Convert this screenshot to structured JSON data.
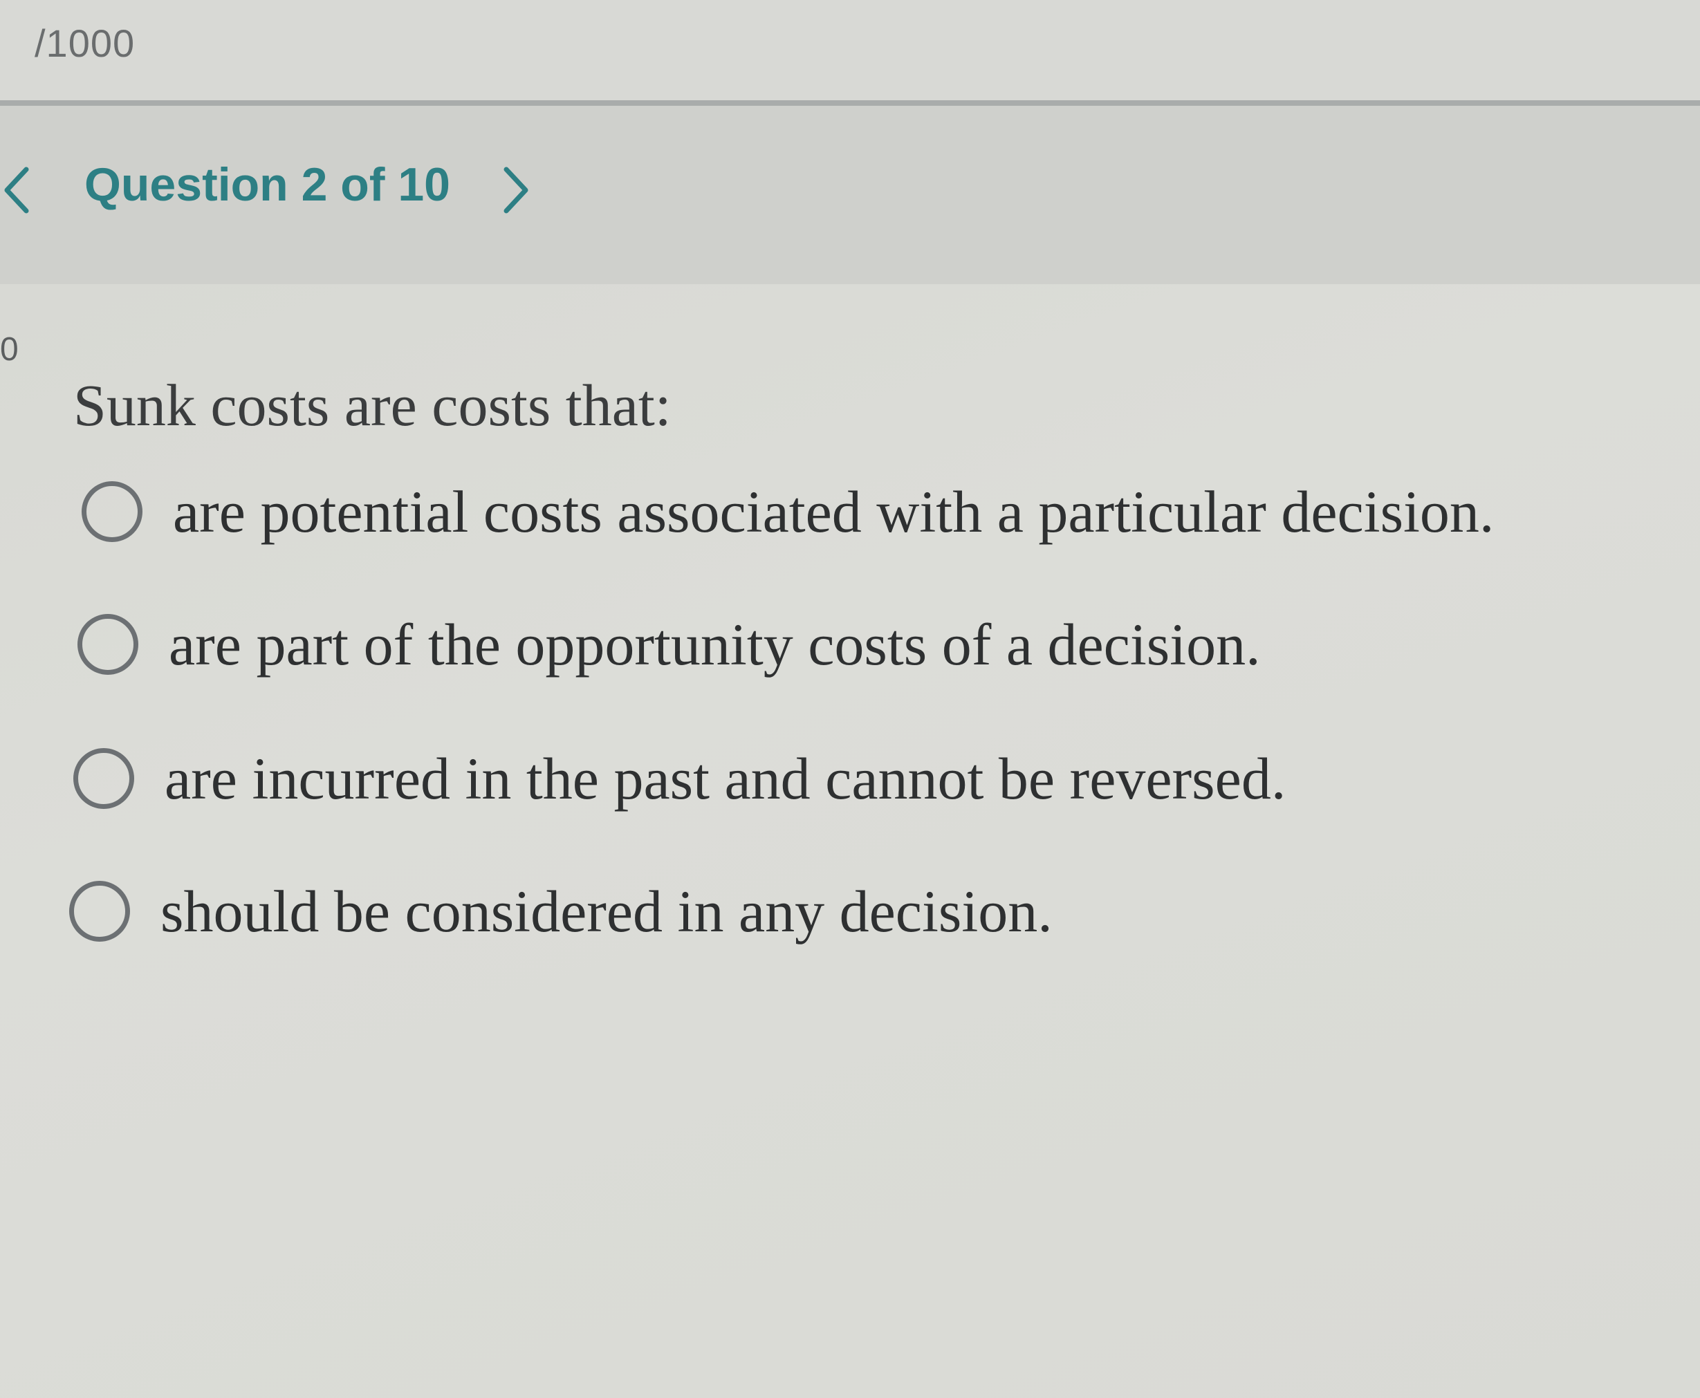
{
  "header": {
    "score_suffix": "/1000"
  },
  "nav": {
    "title": "Question 2 of 10"
  },
  "sidebar": {
    "fragment": "0"
  },
  "question": {
    "text": "Sunk costs are costs that:",
    "options": [
      {
        "label": "are potential costs associated with a particular decision.",
        "selected": false
      },
      {
        "label": "are part of the opportunity costs of a decision.",
        "selected": false
      },
      {
        "label": "are incurred in the past and cannot be reversed.",
        "selected": false
      },
      {
        "label": "should be considered in any decision.",
        "selected": false
      }
    ]
  },
  "colors": {
    "accent": "#2d7f84",
    "text": "#2e3031",
    "radio_border": "#6c7073",
    "background": "#d9dad5"
  },
  "icons": {
    "prev": "chevron-left-icon",
    "next": "chevron-right-icon",
    "option": "radio-button-icon"
  }
}
